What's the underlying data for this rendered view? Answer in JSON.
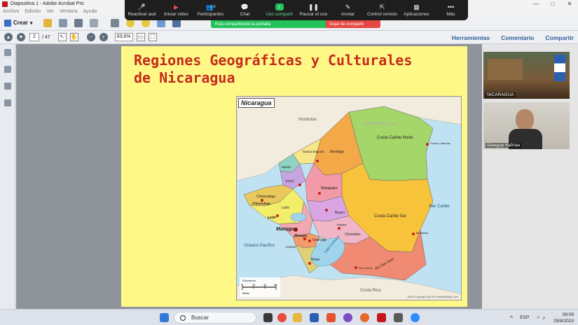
{
  "window": {
    "title": "Diapositiva 1 - Adobe Acrobat Pro",
    "controls": [
      "—",
      "□",
      "✕"
    ]
  },
  "menubar": [
    "Archivo",
    "Edición",
    "Ver",
    "Ventana",
    "Ayuda"
  ],
  "toolbar": {
    "crear_label": "Crear",
    "page_current": "2",
    "page_total": "/ 47",
    "zoom": "83,6%",
    "right_links": [
      "Herramientas",
      "Comentario",
      "Compartir"
    ]
  },
  "zoom_meeting": {
    "buttons": [
      {
        "label": "Reactivar aud",
        "icon": "mic-muted-icon"
      },
      {
        "label": "Iniciar video",
        "icon": "video-off-icon"
      },
      {
        "label": "Participantes",
        "icon": "participants-icon",
        "count": "6"
      },
      {
        "label": "Chat",
        "icon": "chat-icon"
      },
      {
        "label": "Uso comparti",
        "icon": "share-screen-icon"
      },
      {
        "label": "Pausar el uso",
        "icon": "pause-icon"
      },
      {
        "label": "Anotar",
        "icon": "annotate-icon"
      },
      {
        "label": "Control remoto",
        "icon": "remote-control-icon"
      },
      {
        "label": "Aplicaciones",
        "icon": "apps-icon"
      },
      {
        "label": "Más",
        "icon": "more-icon"
      }
    ],
    "sharing_notice": "Está compartiendo la pantalla",
    "stop_sharing": "Dejar de compartir",
    "accent_green": "#23c25a",
    "stop_red": "#e5483f"
  },
  "slide": {
    "title_line1": "Regiones Geográficas y Culturales",
    "title_line2": "de Nicaragua",
    "map": {
      "label": "Nicaragua",
      "honduras": "Honduras",
      "costa_rica": "Costa Rica",
      "mar_caribe": "Mar Caribe",
      "oceano": "Océano Pacífico",
      "lago": "Lago Cocibolca",
      "regions": [
        "Costa Caribe Norte",
        "Costa Caribe Sur",
        "Jinotega",
        "Nueva Segovia",
        "Madriz",
        "Estelí",
        "Matagalpa",
        "Boaco",
        "Chontales",
        "Chinandega",
        "León",
        "Managua",
        "Masaya",
        "Granada",
        "Rivas",
        "Río San Juan",
        "Carazo"
      ],
      "cities": [
        "Puerto Cabezas",
        "Bluefields",
        "Managua",
        "León",
        "Chinandega",
        "Matagalpa",
        "Jinotega",
        "Estelí",
        "Granada",
        "Masaya",
        "Rivas",
        "Juigalpa",
        "Boaco",
        "San Carlos"
      ],
      "scale_km": [
        "0",
        "20",
        "40",
        "60"
      ],
      "scale_unit_km": "Kilómetros",
      "scale_unit_mi": "Millas",
      "copyright": "2020 Copyright @ OnTheWorldMap.com",
      "watermark": "OnTheWorldMap.com"
    }
  },
  "participants": [
    {
      "name": "NICARAGUA"
    },
    {
      "name": "Шандор Кайтан"
    }
  ],
  "taskbar": {
    "search": "Buscar",
    "lang": "ESP",
    "time": "09:09",
    "date": "25/8/2023"
  }
}
